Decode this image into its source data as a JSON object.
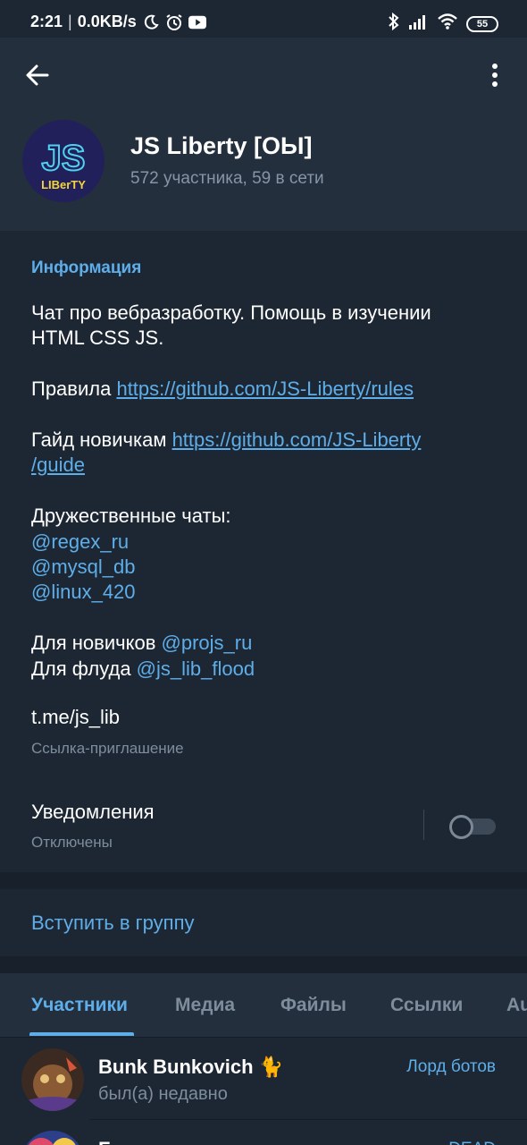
{
  "status_bar": {
    "time": "2:21",
    "net_speed": "0.0KB/s",
    "battery": "55",
    "icons": [
      "moon-icon",
      "alarm-icon",
      "youtube-icon",
      "bluetooth-icon",
      "signal-icon",
      "wifi-icon",
      "battery-icon"
    ]
  },
  "header": {
    "back_icon": "arrow-left-icon",
    "more_icon": "kebab-menu-icon",
    "avatar_text_top": "JS",
    "avatar_text_bottom": "LIBerTY",
    "title": "JS Liberty [ОЫ]",
    "subtitle": "572 участника, 59 в сети"
  },
  "info": {
    "heading": "Информация",
    "desc_line1": "Чат про вебразработку. Помощь в изучении",
    "desc_line2": "HTML CSS JS.",
    "rules_label": "Правила ",
    "rules_url": "https://github.com/JS-Liberty/rules",
    "guide_label": "Гайд новичкам ",
    "guide_url_part1": "https://github.com/JS-Liberty",
    "guide_url_part2": "/guide",
    "friendly_label": "Дружественные чаты:",
    "friendly_chats": [
      "@regex_ru",
      "@mysql_db",
      "@linux_420"
    ],
    "newbies_label": "Для новичков ",
    "newbies_handle": "@projs_ru",
    "flood_label": "Для флуда ",
    "flood_handle": "@js_lib_flood",
    "invite_link": "t.me/js_lib",
    "invite_caption": "Ссылка-приглашение",
    "notifications_label": "Уведомления",
    "notifications_status": "Отключены",
    "notifications_enabled": false
  },
  "join": {
    "label": "Вступить в группу"
  },
  "tabs": {
    "items": [
      "Участники",
      "Медиа",
      "Файлы",
      "Ссылки",
      "Au"
    ],
    "active": "Участники"
  },
  "members": [
    {
      "name": "Bunk Bunkovich 🐈",
      "status": "был(а) недавно",
      "role": "Лорд ботов"
    },
    {
      "name": "Foma",
      "status": "",
      "role": "DEAD"
    }
  ],
  "colors": {
    "accent": "#5eaeea",
    "header_bg": "#242f3d",
    "page_bg": "#1d2733",
    "secondary_text": "#7e8d9c",
    "separator": "#18212b"
  }
}
